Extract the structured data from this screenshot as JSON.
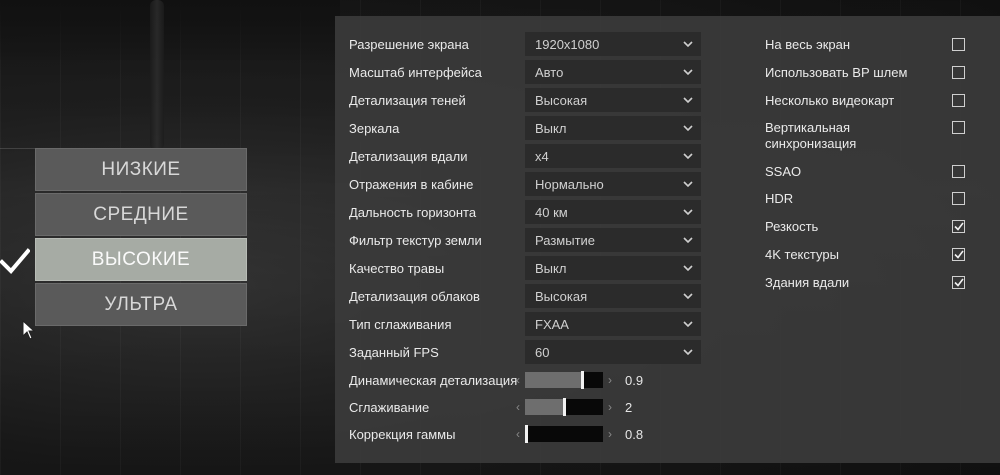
{
  "presets": {
    "items": [
      {
        "label": "НИЗКИЕ",
        "active": false
      },
      {
        "label": "СРЕДНИЕ",
        "active": false
      },
      {
        "label": "ВЫСОКИЕ",
        "active": true
      },
      {
        "label": "УЛЬТРА",
        "active": false
      }
    ]
  },
  "settings": {
    "dropdowns": [
      {
        "label": "Разрешение экрана",
        "value": "1920x1080"
      },
      {
        "label": "Масштаб интерфейса",
        "value": "Авто"
      },
      {
        "label": "Детализация теней",
        "value": "Высокая"
      },
      {
        "label": "Зеркала",
        "value": "Выкл"
      },
      {
        "label": "Детализация вдали",
        "value": "x4"
      },
      {
        "label": "Отражения в кабине",
        "value": "Нормально"
      },
      {
        "label": "Дальность горизонта",
        "value": "40 км"
      },
      {
        "label": "Фильтр текстур земли",
        "value": "Размытие"
      },
      {
        "label": "Качество травы",
        "value": "Выкл"
      },
      {
        "label": "Детализация облаков",
        "value": "Высокая"
      },
      {
        "label": "Тип сглаживания",
        "value": "FXAA"
      },
      {
        "label": "Заданный FPS",
        "value": "60"
      }
    ],
    "sliders": [
      {
        "label": "Динамическая детализация",
        "value": "0.9",
        "level": 0.75
      },
      {
        "label": "Сглаживание",
        "value": "2",
        "level": 0.5
      },
      {
        "label": "Коррекция гаммы",
        "value": "0.8",
        "level": 0.0
      }
    ],
    "checkboxes": [
      {
        "label": "На весь экран",
        "checked": false
      },
      {
        "label": "Использовать ВР шлем",
        "checked": false
      },
      {
        "label": "Несколько видеокарт",
        "checked": false
      },
      {
        "label": "Вертикальная синхронизация",
        "checked": false
      },
      {
        "label": "SSAO",
        "checked": false
      },
      {
        "label": "HDR",
        "checked": false
      },
      {
        "label": "Резкость",
        "checked": true
      },
      {
        "label": "4K текстуры",
        "checked": true
      },
      {
        "label": "Здания вдали",
        "checked": true
      }
    ]
  },
  "icons": {
    "dropdown": "chevron-down-icon",
    "slider_left": "chevron-left-icon",
    "slider_right": "chevron-right-icon",
    "active_preset": "checkmark-icon",
    "pointer": "mouse-cursor-icon"
  },
  "colors": {
    "panel_bg": "#3a3a3a",
    "field_bg": "#2b2b2b",
    "preset_bg": "#5a5a5a",
    "preset_active_bg": "#a6aba4"
  }
}
